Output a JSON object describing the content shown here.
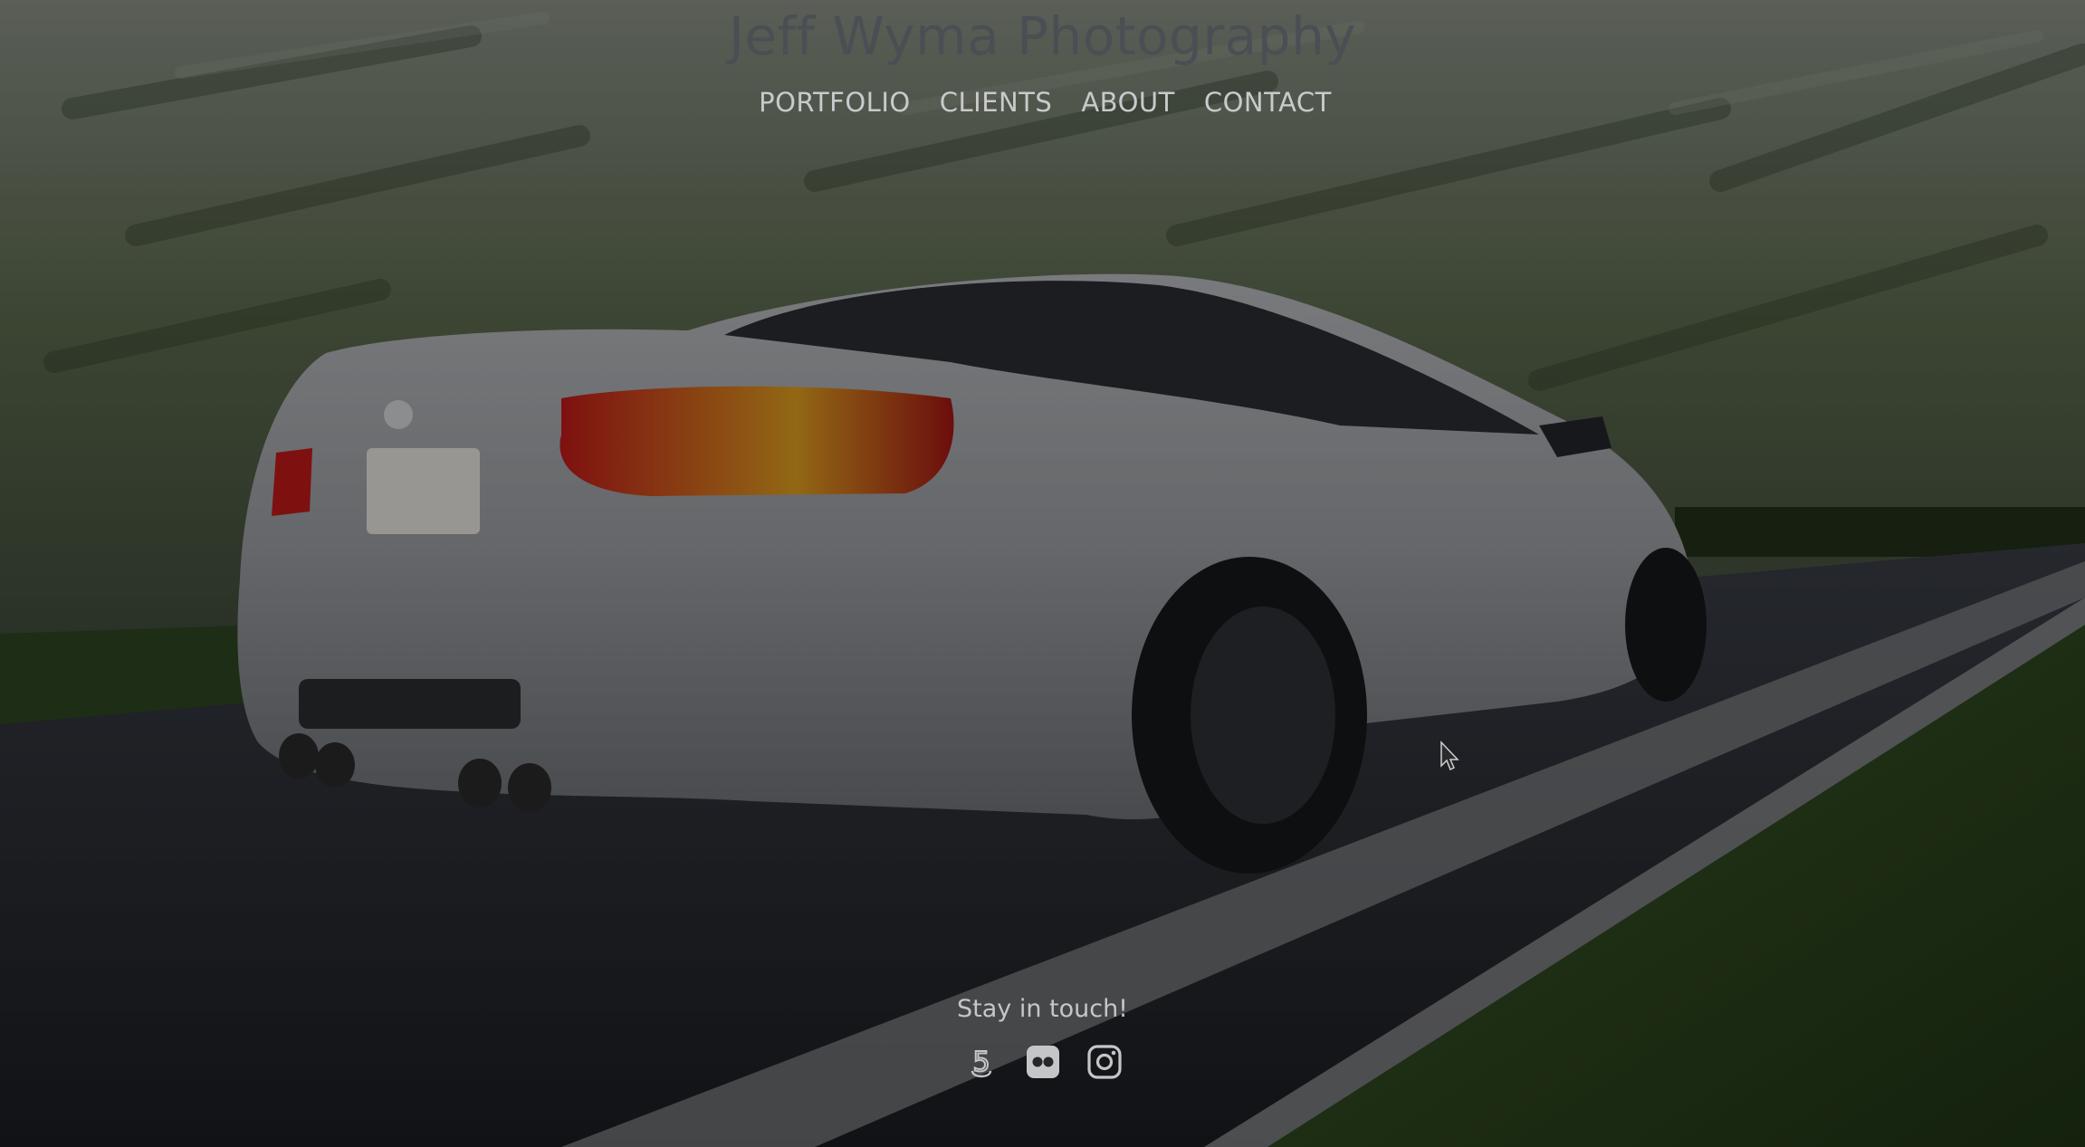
{
  "site": {
    "title": "Jeff Wyma Photography"
  },
  "nav": {
    "items": [
      {
        "label": "PORTFOLIO"
      },
      {
        "label": "CLIENTS"
      },
      {
        "label": "ABOUT"
      },
      {
        "label": "CONTACT"
      }
    ]
  },
  "footer": {
    "tagline": "Stay in touch!",
    "social": [
      {
        "icon": "500px-icon"
      },
      {
        "icon": "flickr-icon"
      },
      {
        "icon": "instagram-icon"
      }
    ]
  },
  "colors": {
    "title": "#4a4f54",
    "nav_text": "#c9cacb",
    "footer_text": "#c5c6c7"
  }
}
